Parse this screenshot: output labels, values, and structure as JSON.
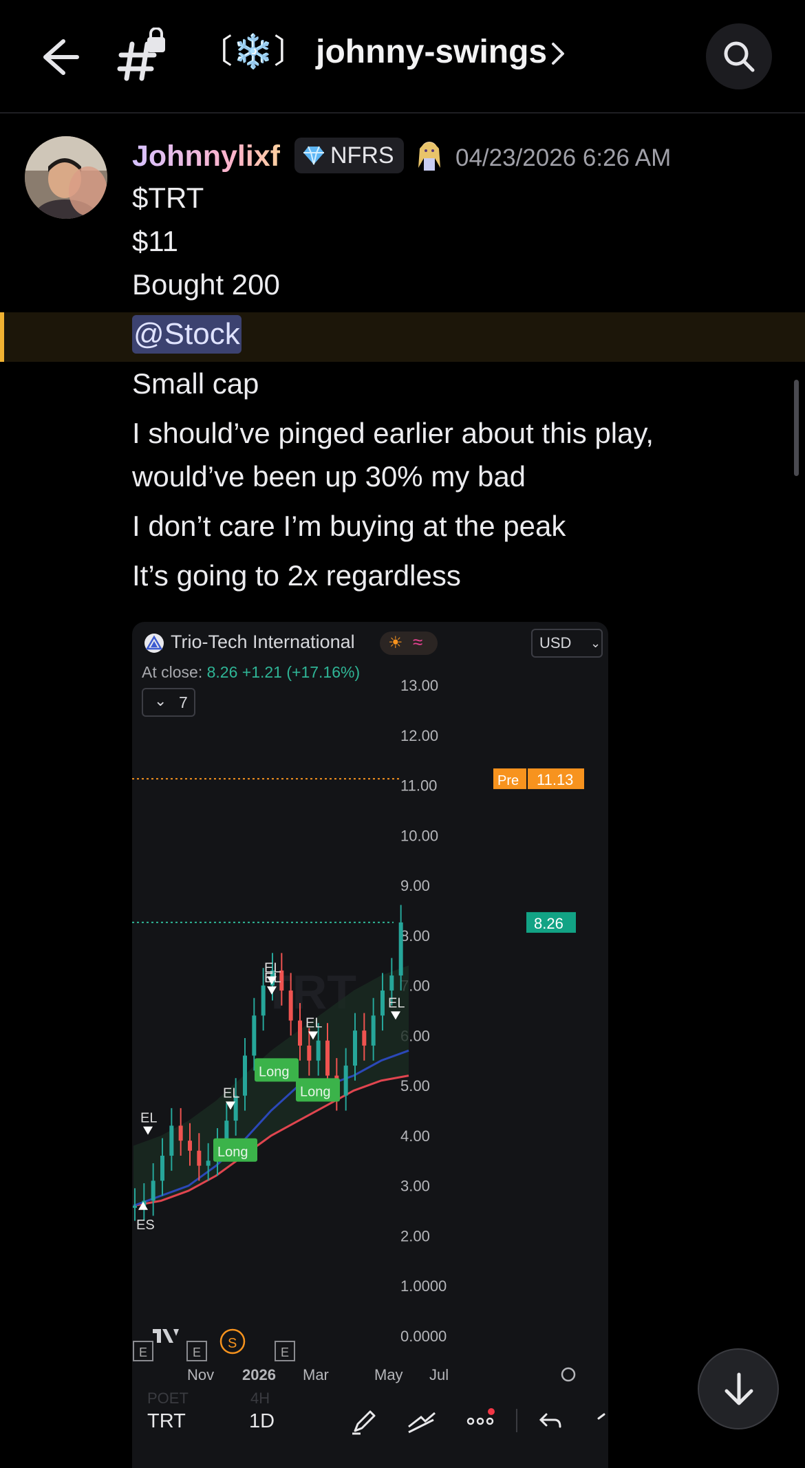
{
  "header": {
    "channel_name": "johnny-swings",
    "channel_prefix": "〔❄️〕"
  },
  "message": {
    "author": "Johnnylixf",
    "badge": "NFRS",
    "timestamp": "04/23/2026 6:26 AM",
    "lines": [
      "$TRT",
      "$11",
      "Bought 200"
    ],
    "mention": "@Stock",
    "lines_after": [
      "Small cap",
      "I should’ve pinged earlier about this play,",
      "would’ve been up 30% my bad",
      "I don’t care I’m buying at the peak",
      "It’s going to 2x regardless"
    ]
  },
  "chart_embed": {
    "title": "Trio-Tech International",
    "currency": "USD",
    "at_close_label": "At close:",
    "at_close_value": "8.26 +1.21 (+17.16%)",
    "collapse_count": "7",
    "pre_label": "Pre",
    "pre_value": "11.13",
    "last_value": "8.26",
    "watermark": "TRT"
  },
  "chart_data": {
    "type": "line",
    "title": "Trio-Tech International",
    "yaxis_ticks": [
      "13.00",
      "12.00",
      "11.00",
      "10.00",
      "9.00",
      "8.00",
      "7.00",
      "6.00",
      "5.00",
      "4.00",
      "3.00",
      "2.00",
      "1.0000",
      "0.0000"
    ],
    "xaxis_ticks": [
      "Nov",
      "2026",
      "Mar",
      "May",
      "Jul"
    ],
    "ylim": [
      0,
      13
    ],
    "price_lines": [
      {
        "label": "Pre",
        "value": 11.13
      },
      {
        "label": "",
        "value": 8.26
      }
    ],
    "signals": [
      {
        "label": "ES",
        "x": "Oct",
        "y": 2.6
      },
      {
        "label": "EL",
        "x": "Oct",
        "y": 4.1
      },
      {
        "label": "Long",
        "x": "Dec",
        "y": 3.7
      },
      {
        "label": "EL",
        "x": "Dec",
        "y": 4.6
      },
      {
        "label": "EL",
        "x": "Jan",
        "y": 6.9
      },
      {
        "label": "EL",
        "x": "Jan",
        "y": 7.1
      },
      {
        "label": "Long",
        "x": "Jan",
        "y": 5.3
      },
      {
        "label": "EL",
        "x": "Feb",
        "y": 6.0
      },
      {
        "label": "Long",
        "x": "Feb",
        "y": 4.9
      },
      {
        "label": "EL",
        "x": "Apr",
        "y": 6.4
      }
    ],
    "series": [
      {
        "name": "",
        "color": "#e0454f",
        "values": [
          2.6,
          2.7,
          2.9,
          3.2,
          3.6,
          4.0,
          4.3,
          4.6,
          4.9,
          5.1,
          5.2
        ]
      },
      {
        "name": "",
        "color": "#2b48b8",
        "values": [
          2.6,
          2.8,
          3.0,
          3.4,
          3.9,
          4.5,
          5.0,
          5.0,
          5.2,
          5.5,
          5.7
        ]
      }
    ],
    "grid": false
  },
  "chart_bottom": {
    "ticker": "TRT",
    "interval": "1D",
    "sub1": "POET",
    "sub2": "4H",
    "event_E": "E",
    "event_S": "S"
  },
  "colors": {
    "accent_mention": "#f0b232",
    "price_up": "#2fb596",
    "pre_market": "#f7931e"
  }
}
